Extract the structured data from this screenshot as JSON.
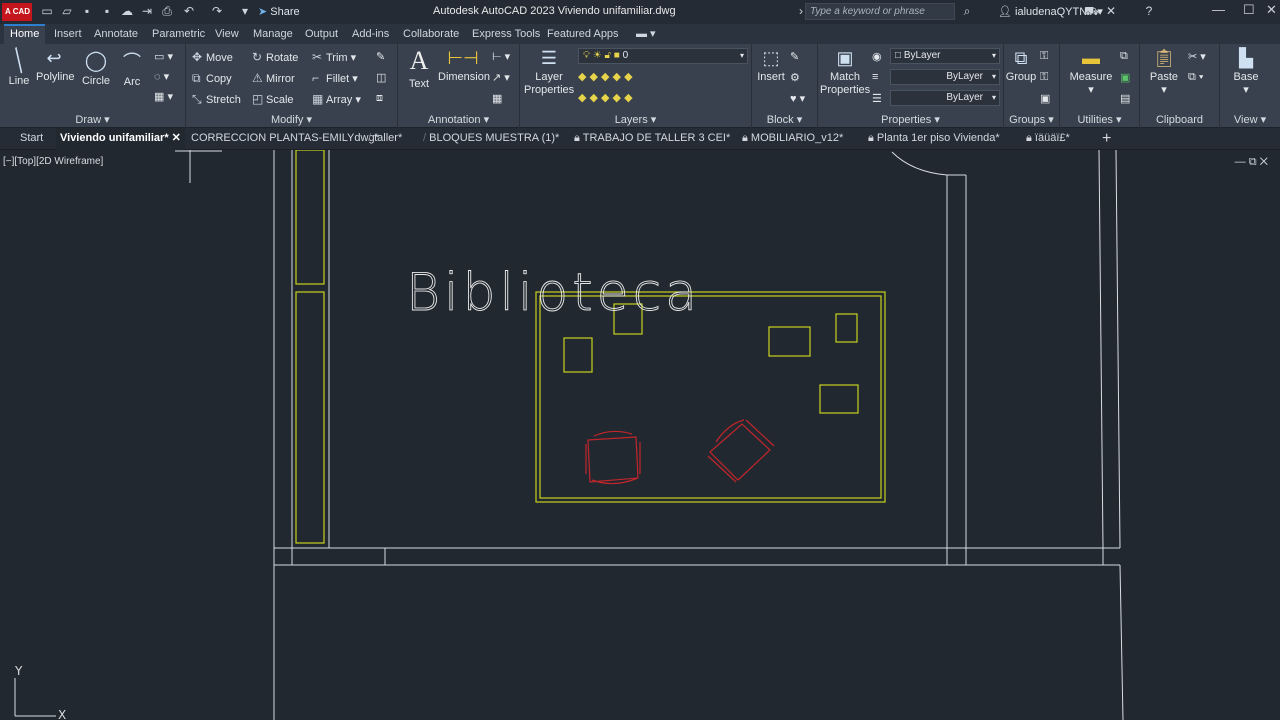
{
  "app": {
    "logo_text": "A CAD",
    "title": "Autodesk AutoCAD 2023   Viviendo unifamiliar.dwg",
    "share_label": "Share",
    "search_placeholder": "Type a keyword or phrase",
    "user": "ialudenaQYTNY"
  },
  "ribbon_tabs": [
    "Home",
    "Insert",
    "Annotate",
    "Parametric",
    "View",
    "Manage",
    "Output",
    "Add-ins",
    "Collaborate",
    "Express Tools",
    "Featured Apps"
  ],
  "panels": {
    "draw": {
      "label": "Draw",
      "tools": [
        "Line",
        "Polyline",
        "Circle",
        "Arc"
      ]
    },
    "modify": {
      "label": "Modify",
      "tools": [
        "Move",
        "Rotate",
        "Trim",
        "Copy",
        "Mirror",
        "Fillet",
        "Stretch",
        "Scale",
        "Array"
      ]
    },
    "annotation": {
      "label": "Annotation",
      "tools": [
        "Text",
        "Dimension"
      ]
    },
    "layers": {
      "label": "Layers",
      "tool": "Layer Properties",
      "current_layer": "0"
    },
    "block": {
      "label": "Block",
      "tool": "Insert"
    },
    "properties": {
      "label": "Properties",
      "tool": "Match Properties",
      "color": "ByLayer",
      "linetype": "ByLayer",
      "lineweight": "ByLayer"
    },
    "groups": {
      "label": "Groups",
      "tool": "Group"
    },
    "utilities": {
      "label": "Utilities",
      "tool": "Measure"
    },
    "clipboard": {
      "label": "Clipboard",
      "tool": "Paste"
    },
    "view": {
      "label": "View",
      "tool": "Base"
    }
  },
  "file_tabs": [
    "Start",
    "Viviendo unifamiliar*",
    "CORRECCION PLANTAS-EMILYdwg*",
    "taller*",
    "BLOQUES MUESTRA (1)*",
    "TRABAJO DE TALLER 3 CEI*",
    "MOBILIARIO_v12*",
    "Planta 1er piso Vivienda*",
    "ïäüäï£*"
  ],
  "viewport": {
    "label": "[−][Top][2D Wireframe]",
    "drawing_text": "Biblioteca",
    "ucs_y": "Y",
    "ucs_x": "X"
  },
  "colors": {
    "accent": "#2f7fd0",
    "furniture": "#c8d21e",
    "chairs": "#c0262b",
    "walls": "#d8dde2"
  }
}
